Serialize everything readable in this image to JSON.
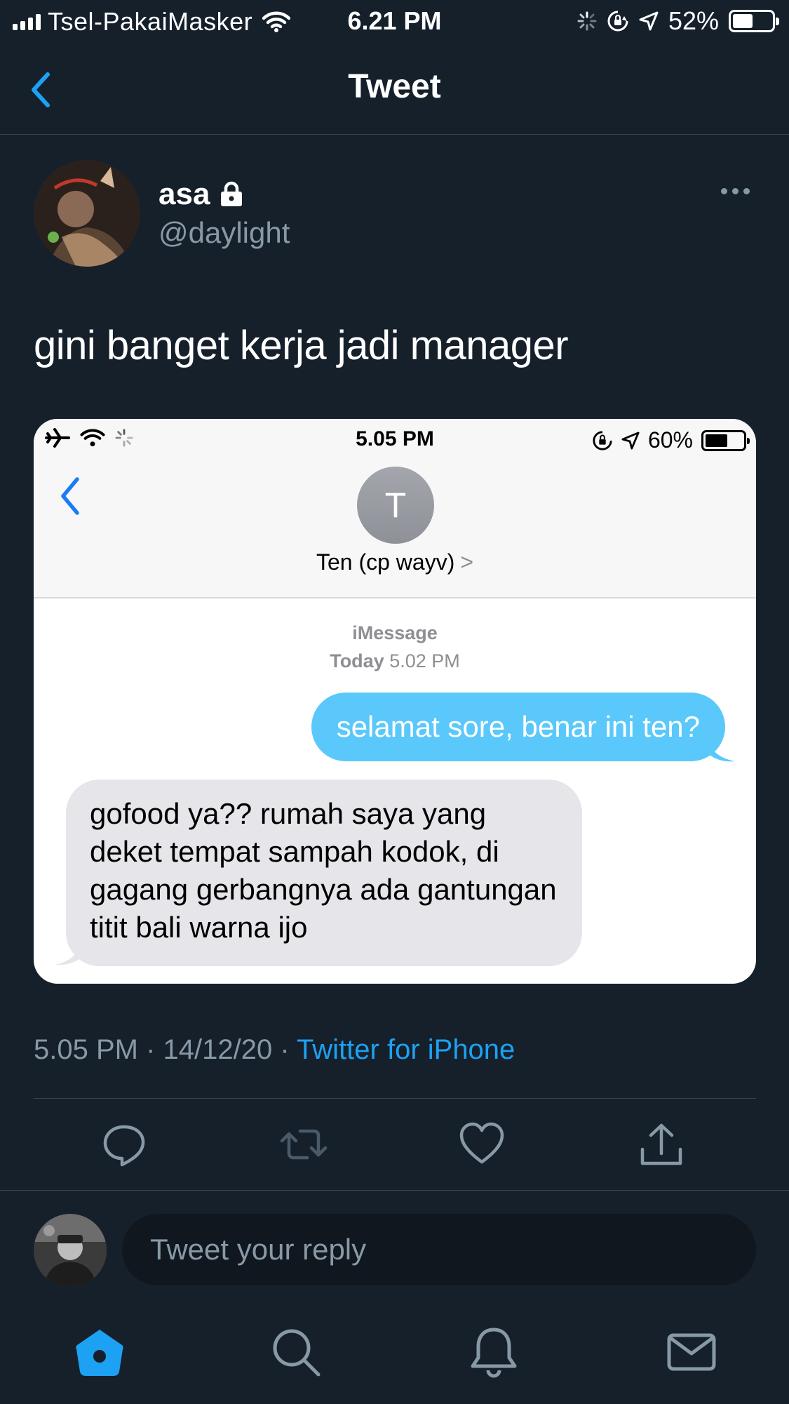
{
  "status_bar": {
    "carrier": "Tsel-PakaiMasker",
    "time": "6.21 PM",
    "battery": "52%",
    "battery_level": 0.52
  },
  "nav": {
    "title": "Tweet",
    "back_icon": "chevron-left-icon"
  },
  "tweet": {
    "author_name": "asa",
    "author_handle": "@daylight",
    "locked_icon": "lock-icon",
    "text": "gini banget kerja jadi manager",
    "timestamp": "5.05 PM · 14/12/20 · ",
    "source": "Twitter for iPhone",
    "media": {
      "status_time": "5.05 PM",
      "status_battery": "60%",
      "battery_level": 0.6,
      "contact_initial": "T",
      "contact_name": "Ten (cp wayv)",
      "contact_chevron": ">",
      "service_label": "iMessage",
      "date_day": "Today",
      "date_time": "5.02 PM",
      "outgoing": "selamat sore, benar ini ten?",
      "incoming": "gofood ya?? rumah saya yang deket tempat sampah kodok, di gagang gerbangnya ada gantungan titit bali warna ijo"
    }
  },
  "actions": {
    "reply": "reply-icon",
    "retweet": "retweet-icon",
    "like": "heart-icon",
    "share": "share-icon"
  },
  "reply": {
    "placeholder": "Tweet your reply"
  },
  "tabbar": {
    "items": [
      "home-icon",
      "search-icon",
      "bell-icon",
      "mail-icon"
    ]
  },
  "colors": {
    "background": "#15202b",
    "accent": "#1da1f2",
    "secondary_text": "#8899a6",
    "outgoing_bubble": "#5ac8fa",
    "incoming_bubble": "#e5e5ea"
  }
}
